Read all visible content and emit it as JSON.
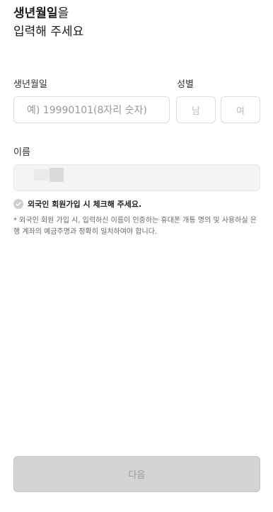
{
  "heading": {
    "line1_bold": "생년월일",
    "line1_rest": "을",
    "line2": "입력해 주세요"
  },
  "birth": {
    "label": "생년월일",
    "placeholder": "예) 19990101(8자리 숫자)",
    "value": ""
  },
  "gender": {
    "label": "성별",
    "male": "남",
    "female": "여"
  },
  "name": {
    "label": "이름"
  },
  "foreigner": {
    "checkbox_label": "외국인 회원가입 시 체크해 주세요.",
    "checked": false
  },
  "notice": {
    "text": "* 외국인 회원 가입 시, 입력하신 이름이 인증하는 휴대폰 개통 명의 및 사용하실 은행 계좌의 예금주명과 정확히 일치하여야 합니다."
  },
  "next_button": {
    "label": "다음"
  }
}
